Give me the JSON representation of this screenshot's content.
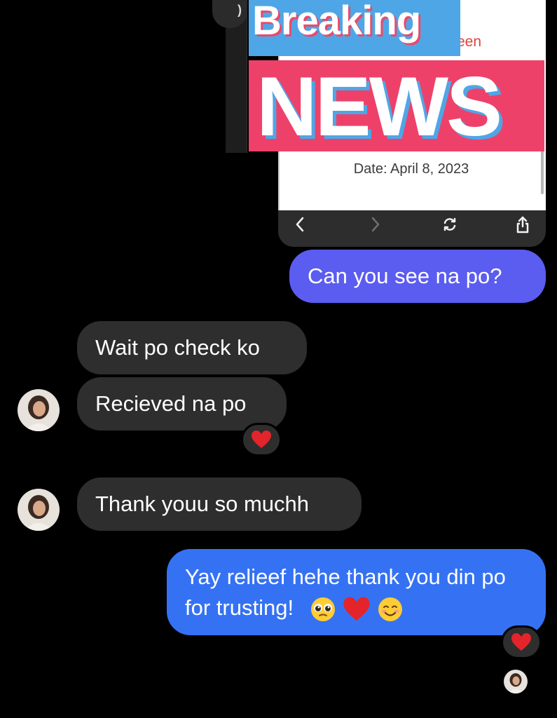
{
  "shared_screenshot": {
    "fragment_text": "een",
    "date_text": "Date: April 8, 2023",
    "toolbar": {
      "back_icon": "chevron-left-icon",
      "forward_icon": "chevron-right-icon",
      "reload_icon": "reload-icon",
      "share_icon": "share-icon"
    },
    "corner_icon": "info-icon"
  },
  "sticker": {
    "line1": "Breaking",
    "line2": "NEWS",
    "colors": {
      "blue": "#4fa6e6",
      "pink": "#ee4169"
    }
  },
  "messages": [
    {
      "sender": "me",
      "text": "Can you see na po?"
    },
    {
      "sender": "them",
      "text": "Wait po check ko"
    },
    {
      "sender": "them",
      "text": "Recieved na po",
      "reaction": "heart"
    },
    {
      "sender": "them",
      "text": "Thank youu so muchh"
    },
    {
      "sender": "me",
      "text": "Yay relieef hehe thank you din po for trusting!",
      "emojis": [
        "pleading-face",
        "heart",
        "smiling-face"
      ],
      "reaction": "heart"
    }
  ],
  "colors": {
    "incoming_bubble": "#2e2e2e",
    "outgoing_purple": "#5b5cf0",
    "outgoing_blue": "#3572f3",
    "background": "#000000",
    "heart": "#e3242b"
  }
}
